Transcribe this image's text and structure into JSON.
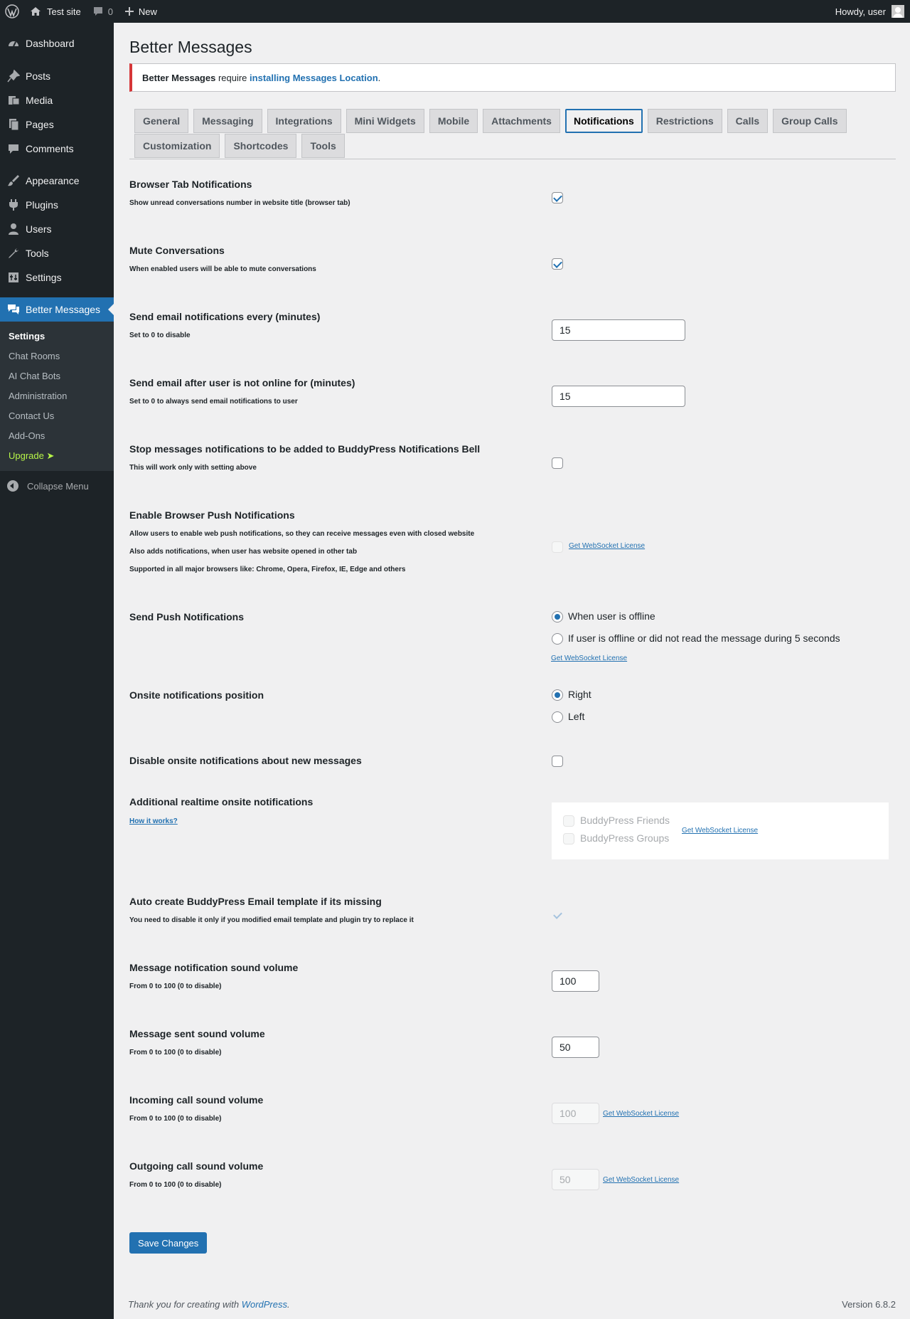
{
  "adminbar": {
    "site_name": "Test site",
    "comments_count": "0",
    "new_label": "New",
    "howdy": "Howdy, user"
  },
  "sidebar": {
    "items": [
      {
        "label": "Dashboard",
        "icon": "dashboard-icon"
      },
      {
        "label": "Posts",
        "icon": "pin-icon"
      },
      {
        "label": "Media",
        "icon": "media-icon"
      },
      {
        "label": "Pages",
        "icon": "pages-icon"
      },
      {
        "label": "Comments",
        "icon": "comment-icon"
      },
      {
        "label": "Appearance",
        "icon": "brush-icon"
      },
      {
        "label": "Plugins",
        "icon": "plug-icon"
      },
      {
        "label": "Users",
        "icon": "user-icon"
      },
      {
        "label": "Tools",
        "icon": "wrench-icon"
      },
      {
        "label": "Settings",
        "icon": "settings-icon"
      },
      {
        "label": "Better Messages",
        "icon": "messages-icon"
      }
    ],
    "submenu": [
      "Settings",
      "Chat Rooms",
      "AI Chat Bots",
      "Administration",
      "Contact Us",
      "Add-Ons",
      "Upgrade ➤"
    ],
    "collapse": "Collapse Menu"
  },
  "page": {
    "title": "Better Messages",
    "notice": {
      "bold": "Better Messages",
      "text": " require ",
      "link": "installing Messages Location",
      "end": "."
    }
  },
  "tabs": [
    "General",
    "Messaging",
    "Integrations",
    "Mini Widgets",
    "Mobile",
    "Attachments",
    "Notifications",
    "Restrictions",
    "Calls",
    "Group Calls",
    "Customization",
    "Shortcodes",
    "Tools"
  ],
  "active_tab": "Notifications",
  "settings": {
    "browser_tab": {
      "label": "Browser Tab Notifications",
      "desc": "Show unread conversations number in website title (browser tab)",
      "checked": true
    },
    "mute": {
      "label": "Mute Conversations",
      "desc": "When enabled users will be able to mute conversations",
      "checked": true
    },
    "email_every": {
      "label": "Send email notifications every (minutes)",
      "desc": "Set to 0 to disable",
      "value": "15"
    },
    "email_offline": {
      "label": "Send email after user is not online for (minutes)",
      "desc": "Set to 0 to always send email notifications to user",
      "value": "15"
    },
    "stop_bell": {
      "label": "Stop messages notifications to be added to BuddyPress Notifications Bell",
      "desc": "This will work only with setting above",
      "checked": false
    },
    "push": {
      "label": "Enable Browser Push Notifications",
      "desc1": "Allow users to enable web push notifications, so they can receive messages even with closed website",
      "desc2": "Also adds notifications, when user has website opened in other tab",
      "desc3": "Supported in all major browsers like: Chrome, Opera, Firefox, IE, Edge and others"
    },
    "send_push": {
      "label": "Send Push Notifications",
      "option1": "When user is offline",
      "option2": "If user is offline or did not read the message during 5 seconds",
      "selected": "When user is offline"
    },
    "onsite_position": {
      "label": "Onsite notifications position",
      "option1": "Right",
      "option2": "Left",
      "selected": "Right"
    },
    "disable_onsite": {
      "label": "Disable onsite notifications about new messages",
      "checked": false
    },
    "additional": {
      "label": "Additional realtime onsite notifications",
      "link": "How it works?",
      "option1": "BuddyPress Friends",
      "option2": "BuddyPress Groups"
    },
    "auto_email": {
      "label": "Auto create BuddyPress Email template if its missing",
      "desc": "You need to disable it only if you modified email template and plugin try to replace it",
      "checked": true
    },
    "notif_volume": {
      "label": "Message notification sound volume",
      "desc": "From 0 to 100 (0 to disable)",
      "value": "100"
    },
    "sent_volume": {
      "label": "Message sent sound volume",
      "desc": "From 0 to 100 (0 to disable)",
      "value": "50"
    },
    "incoming_volume": {
      "label": "Incoming call sound volume",
      "desc": "From 0 to 100 (0 to disable)",
      "value": "100"
    },
    "outgoing_volume": {
      "label": "Outgoing call sound volume",
      "desc": "From 0 to 100 (0 to disable)",
      "value": "50"
    }
  },
  "license_link": "Get WebSocket License",
  "save_label": "Save Changes",
  "footer": {
    "text": "Thank you for creating with ",
    "link": "WordPress",
    "end": ".",
    "version": "Version 6.8.2"
  },
  "colors": {
    "accent": "#2271b1",
    "sidebar": "#1d2327",
    "notice_error": "#d63638",
    "upgrade": "#b7f548"
  }
}
